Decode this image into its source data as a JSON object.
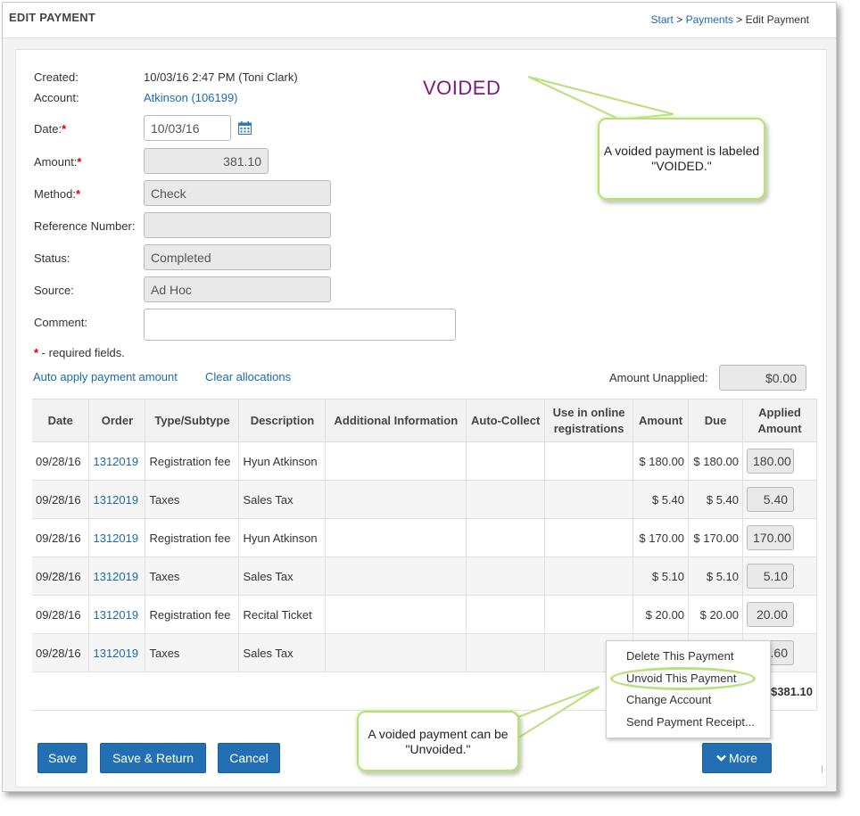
{
  "header": {
    "title": "EDIT PAYMENT",
    "breadcrumb": {
      "start": "Start",
      "sep1": " > ",
      "payments": "Payments",
      "sep2": " > ",
      "current": "Edit Payment"
    }
  },
  "form": {
    "created_label": "Created:",
    "created_value": "10/03/16 2:47 PM (Toni Clark)",
    "account_label": "Account:",
    "account_value": "Atkinson (106199)",
    "date_label": "Date:",
    "date_value": "10/03/16",
    "amount_label": "Amount:",
    "amount_value": "381.10",
    "method_label": "Method:",
    "method_value": "Check",
    "reference_label": "Reference Number:",
    "reference_value": "",
    "status_label": "Status:",
    "status_value": "Completed",
    "source_label": "Source:",
    "source_value": "Ad Hoc",
    "comment_label": "Comment:",
    "comment_value": "",
    "required_star": "*",
    "required_note": " - required fields."
  },
  "voided_label": "VOIDED",
  "callouts": {
    "voided": "A voided payment is labeled \"VOIDED.\"",
    "unvoided": "A voided payment can be \"Unvoided.\""
  },
  "allocation": {
    "auto_apply": "Auto apply payment amount",
    "clear": "Clear allocations",
    "unapplied_label": "Amount Unapplied:",
    "unapplied_value": "$0.00"
  },
  "table": {
    "headers": [
      "Date",
      "Order",
      "Type/Subtype",
      "Description",
      "Additional Information",
      "Auto-Collect",
      "Use in online registrations",
      "Amount",
      "Due",
      "Applied Amount"
    ],
    "rows": [
      {
        "date": "09/28/16",
        "order": "1312019",
        "type": "Registration fee",
        "description": "Hyun Atkinson",
        "amount": "$ 180.00",
        "due": "$ 180.00",
        "applied": "180.00"
      },
      {
        "date": "09/28/16",
        "order": "1312019",
        "type": "Taxes",
        "description": "Sales Tax",
        "amount": "$ 5.40",
        "due": "$ 5.40",
        "applied": "5.40"
      },
      {
        "date": "09/28/16",
        "order": "1312019",
        "type": "Registration fee",
        "description": "Hyun Atkinson",
        "amount": "$ 170.00",
        "due": "$ 170.00",
        "applied": "170.00"
      },
      {
        "date": "09/28/16",
        "order": "1312019",
        "type": "Taxes",
        "description": "Sales Tax",
        "amount": "$ 5.10",
        "due": "$ 5.10",
        "applied": "5.10"
      },
      {
        "date": "09/28/16",
        "order": "1312019",
        "type": "Registration fee",
        "description": "Recital Ticket",
        "amount": "$ 20.00",
        "due": "$ 20.00",
        "applied": "20.00"
      },
      {
        "date": "09/28/16",
        "order": "1312019",
        "type": "Taxes",
        "description": "Sales Tax",
        "amount": "",
        "due": "",
        "applied": ".60"
      }
    ],
    "total": "$381.10"
  },
  "menu": {
    "items": [
      "Delete This Payment",
      "Unvoid This Payment",
      "Change Account",
      "Send Payment Receipt..."
    ]
  },
  "buttons": {
    "save": "Save",
    "save_return": "Save & Return",
    "cancel": "Cancel",
    "more": "More"
  },
  "icons": {
    "calendar": "calendar-icon",
    "more_chevron": "chevron-down-icon"
  },
  "colors": {
    "link": "#1a6ca8",
    "button": "#2270b3",
    "voided": "#7a1a7a",
    "required": "#dd0000",
    "callout_border": "#b8e07a"
  }
}
